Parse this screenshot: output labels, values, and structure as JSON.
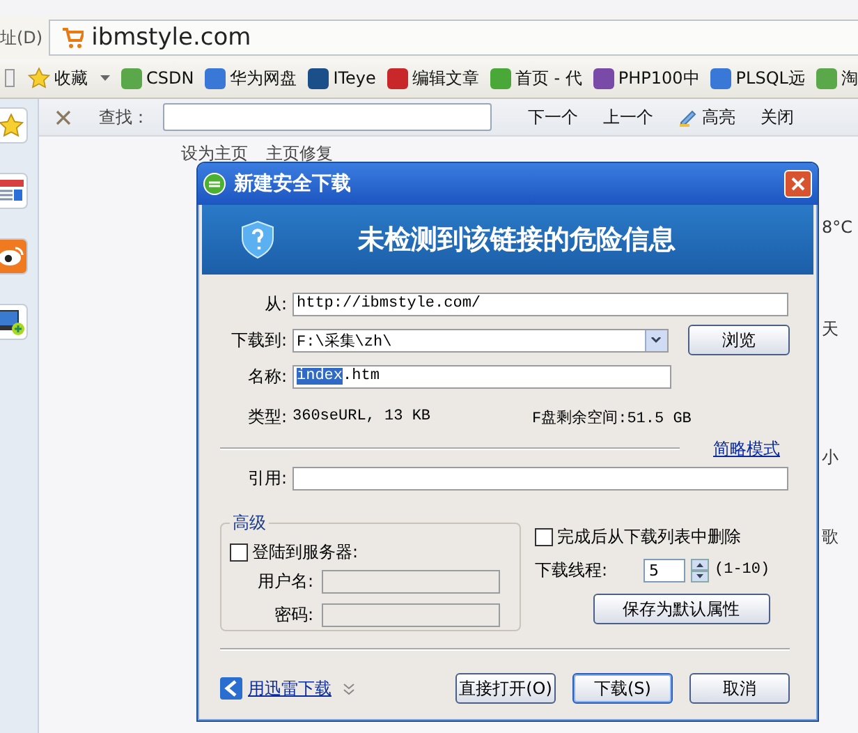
{
  "address_bar": {
    "label": "址(D)",
    "url": "ibmstyle.com"
  },
  "bookmarks": [
    {
      "label": "收藏"
    },
    {
      "label": "CSDN",
      "color": "#5aa84a"
    },
    {
      "label": "华为网盘",
      "color": "#3a78d8"
    },
    {
      "label": "ITeye",
      "color": "#1a4f8a"
    },
    {
      "label": "编辑文章",
      "color": "#c8282a"
    },
    {
      "label": "首页 - 代",
      "color": "#4aa838"
    },
    {
      "label": "PHP100中",
      "color": "#7a4aa8"
    },
    {
      "label": "PLSQL远",
      "color": "#3a78d8"
    },
    {
      "label": "淘",
      "color": "#5aa84a"
    }
  ],
  "find_bar": {
    "label": "查找：",
    "buttons": [
      {
        "label": "下一个",
        "kind": "plain"
      },
      {
        "label": "上一个",
        "kind": "plain"
      },
      {
        "label": "高亮",
        "kind": "highlight"
      },
      {
        "label": "关闭",
        "kind": "plain"
      }
    ]
  },
  "page": {
    "links": [
      "设为主页",
      "主页修复"
    ],
    "fragments": [
      "8°C",
      "天",
      "小",
      "歌"
    ]
  },
  "dialog": {
    "title": "新建安全下载",
    "banner": "未检测到该链接的危险信息",
    "from": {
      "label": "从:",
      "value": "http://ibmstyle.com/"
    },
    "save_to": {
      "label": "下载到:",
      "value": "F:\\采集\\zh\\",
      "button": "浏览"
    },
    "name": {
      "label": "名称:",
      "parts": [
        {
          "text": "index",
          "selected": true
        },
        {
          "text": ".htm",
          "selected": false
        }
      ]
    },
    "type": {
      "label": "类型:",
      "value": "360seURL, 13 KB"
    },
    "free_space": "F盘剩余空间:51.5 GB",
    "mode_link": "简略模式",
    "referer": {
      "label": "引用:"
    },
    "advanced": {
      "title": "高级",
      "login": {
        "label": "登陆到服务器:",
        "checked": false
      },
      "username": {
        "label": "用户名:"
      },
      "password": {
        "label": "密码:"
      }
    },
    "remove_after": {
      "label": "完成后从下载列表中删除",
      "checked": false
    },
    "threads": {
      "label": "下载线程:",
      "value": "5",
      "range": "(1-10)"
    },
    "save_default": "保存为默认属性",
    "thunder_link": "用迅雷下载",
    "buttons": [
      {
        "label": "直接打开(O)",
        "selected": false
      },
      {
        "label": "下载(S)",
        "selected": true
      },
      {
        "label": "取消",
        "selected": false
      }
    ]
  }
}
